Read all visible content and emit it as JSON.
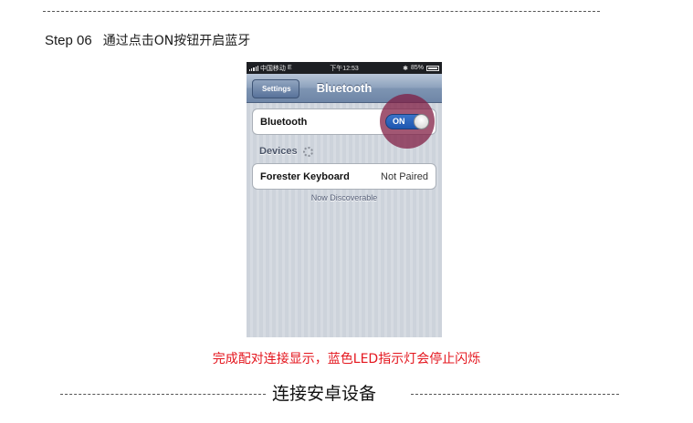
{
  "step": {
    "number": "Step 06",
    "instruction": "通过点击ON按钮开启蓝牙"
  },
  "phone": {
    "status_bar": {
      "carrier": "中国移动",
      "network": "E",
      "time": "下午12:53",
      "battery": "85%"
    },
    "nav": {
      "back_label": "Settings",
      "title": "Bluetooth"
    },
    "bluetooth_row": {
      "label": "Bluetooth",
      "toggle_state": "ON"
    },
    "devices_header": "Devices",
    "device": {
      "name": "Forester Keyboard",
      "status": "Not Paired"
    },
    "footer_note": "Now Discoverable"
  },
  "caption": "完成配对连接显示，蓝色LED指示灯会停止闪烁",
  "section_title": "连接安卓设备",
  "colors": {
    "caption_red": "#e4151d",
    "highlight": "#801c42",
    "toggle_blue": "#2b63bd"
  }
}
